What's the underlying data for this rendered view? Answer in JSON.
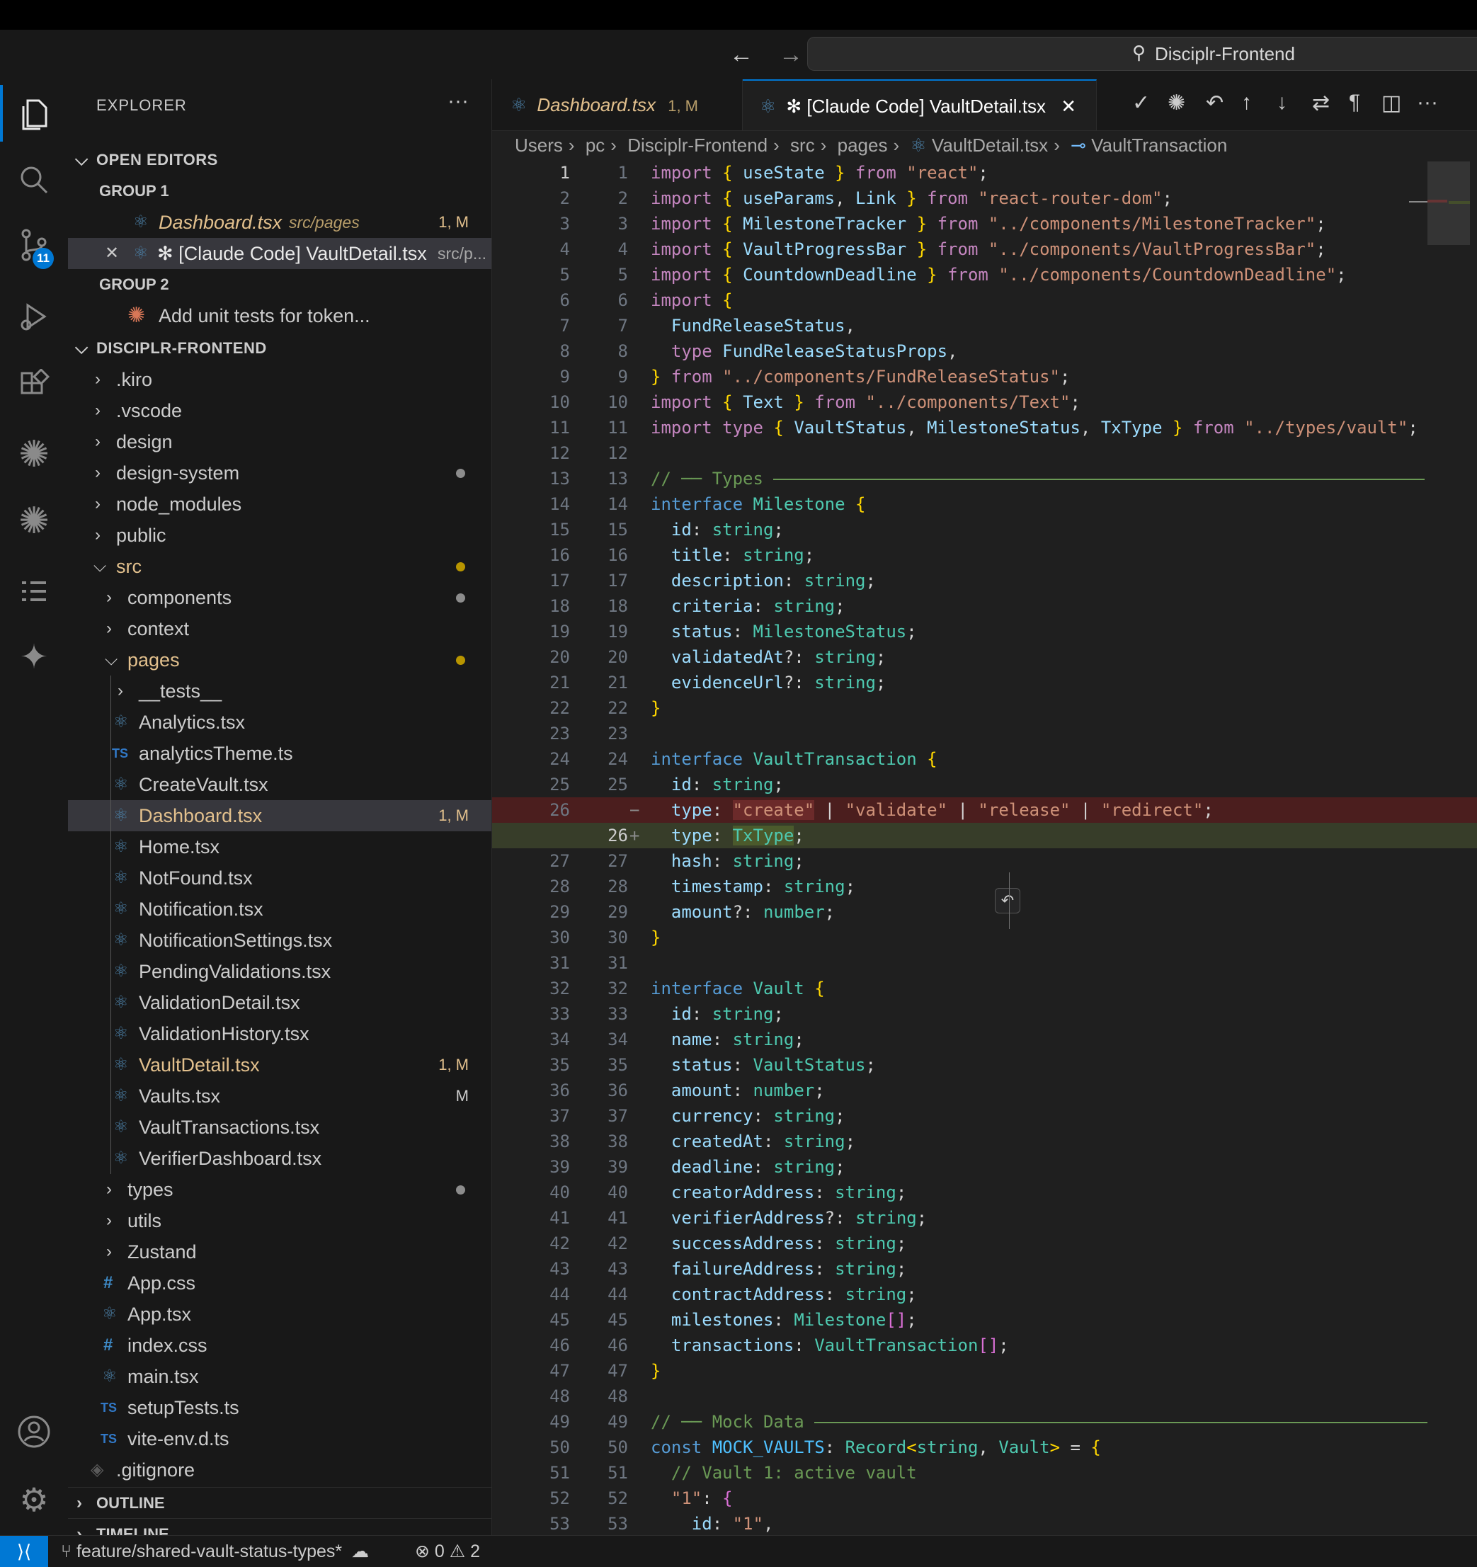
{
  "window": {
    "search": "Disciplr-Frontend"
  },
  "activity": {
    "source_control_badge": "11"
  },
  "explorer": {
    "title": "EXPLORER",
    "more": "···",
    "open_editors": {
      "title": "OPEN EDITORS",
      "group1": "GROUP 1",
      "group2": "GROUP 2",
      "item1_name": "Dashboard.tsx",
      "item1_path": "src/pages",
      "item1_status": "1, M",
      "item2_name": "✻ [Claude Code] VaultDetail.tsx",
      "item2_path": "src/p...",
      "item3_name": "Add unit tests for token..."
    },
    "root": "DISCIPLR-FRONTEND",
    "tree": [
      ".kiro",
      ".vscode",
      "design",
      "design-system",
      "node_modules",
      "public",
      "src",
      "components",
      "context",
      "pages",
      "__tests__",
      "Analytics.tsx",
      "analyticsTheme.ts",
      "CreateVault.tsx",
      "Dashboard.tsx",
      "Home.tsx",
      "NotFound.tsx",
      "Notification.tsx",
      "NotificationSettings.tsx",
      "PendingValidations.tsx",
      "ValidationDetail.tsx",
      "ValidationHistory.tsx",
      "VaultDetail.tsx",
      "Vaults.tsx",
      "VaultTransactions.tsx",
      "VerifierDashboard.tsx",
      "types",
      "utils",
      "Zustand",
      "App.css",
      "App.tsx",
      "index.css",
      "main.tsx",
      "setupTests.ts",
      "vite-env.d.ts",
      ".gitignore"
    ],
    "status_dashboard": "1, M",
    "status_vaultdetail": "1, M",
    "status_vaults": "M",
    "outline": "OUTLINE",
    "timeline": "TIMELINE"
  },
  "tabs": {
    "tab1_name": "Dashboard.tsx",
    "tab1_status": "1, M",
    "tab2_name": "✻ [Claude Code] VaultDetail.tsx"
  },
  "breadcrumbs": [
    "Users",
    "pc",
    "Disciplr-Frontend",
    "src",
    "pages",
    "VaultDetail.tsx",
    "VaultTransaction"
  ],
  "status": {
    "branch": "feature/shared-vault-status-types*",
    "errors": "0",
    "warnings": "2"
  },
  "colors": {
    "accent": "#0078d4",
    "modified": "#e2c08d",
    "deleted_bg": "#4b1e1e",
    "inserted_bg": "#373d29"
  }
}
